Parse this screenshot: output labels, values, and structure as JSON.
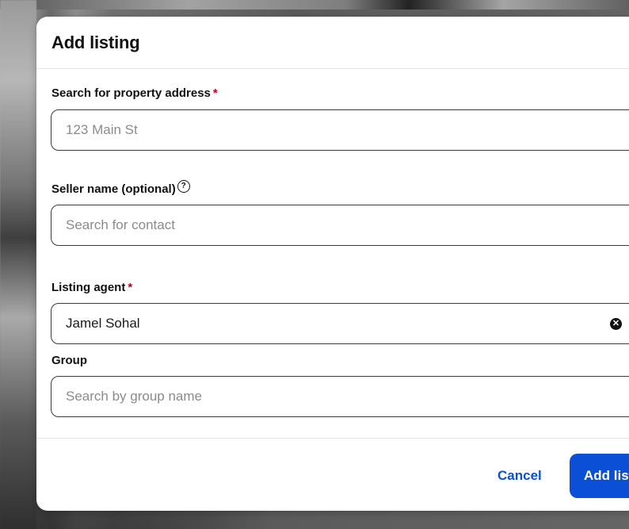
{
  "dialog": {
    "title": "Add listing"
  },
  "fields": {
    "property_address": {
      "label": "Search for property address",
      "required_marker": "*",
      "placeholder": "123 Main St"
    },
    "seller_name": {
      "label": "Seller name (optional)",
      "help_glyph": "?",
      "placeholder": "Search for contact"
    },
    "listing_agent": {
      "label": "Listing agent",
      "required_marker": "*",
      "value": "Jamel Sohal",
      "clear_icon": "x-circle-icon"
    },
    "group": {
      "label": "Group",
      "placeholder": "Search by group name"
    }
  },
  "footer": {
    "cancel_label": "Cancel",
    "submit_label": "Add listing"
  },
  "colors": {
    "primary": "#0a4fd6",
    "required": "#c00018",
    "placeholder": "#8b8b8b"
  }
}
